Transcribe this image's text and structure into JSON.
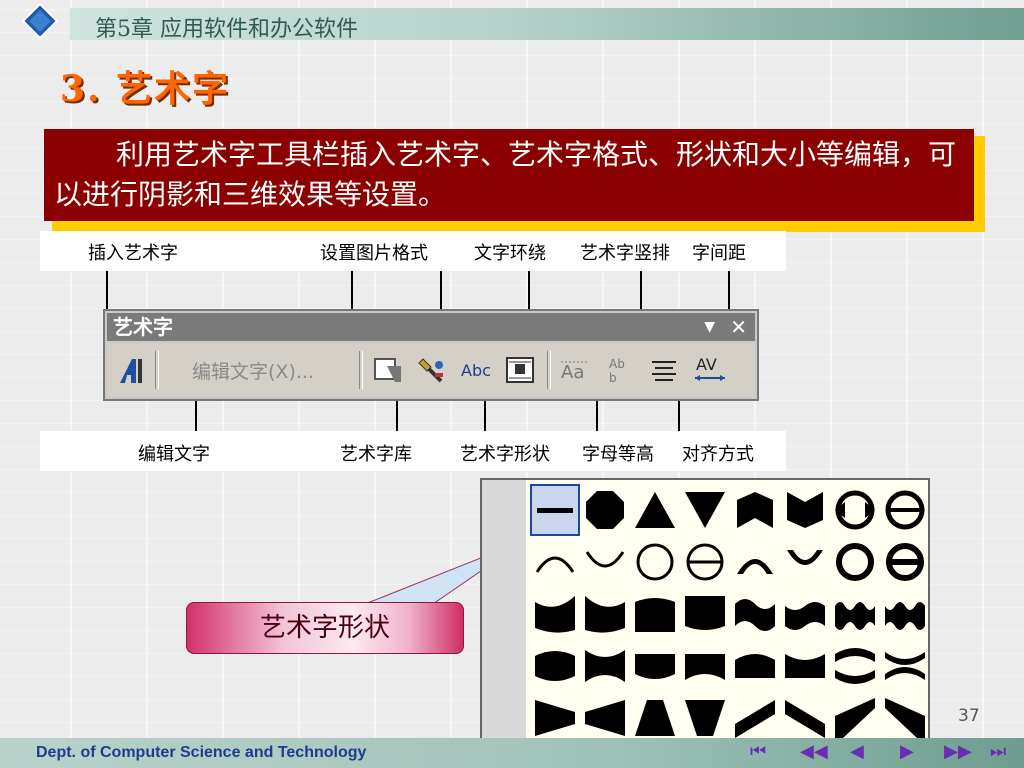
{
  "header": {
    "chapter": "第5章  应用软件和办公软件"
  },
  "heading": "3. 艺术字",
  "textbox": {
    "text": "利用艺术字工具栏插入艺术字、艺术字格式、形状和大小等编辑，可以进行阴影和三维效果等设置。"
  },
  "top_labels": [
    "插入艺术字",
    "设置图片格式",
    "文字环绕",
    "艺术字竖排",
    "字间距"
  ],
  "bottom_labels": [
    "编辑文字",
    "艺术字库",
    "艺术字形状",
    "字母等高",
    "对齐方式"
  ],
  "toolbar": {
    "title": "艺术字",
    "edit_text": "编辑文字(X)...",
    "dropdown_icon": "▼",
    "close_icon": "✕"
  },
  "callout": {
    "label": "艺术字形状"
  },
  "footer": {
    "dept": "Dept. of Computer Science and Technology",
    "page": "37"
  },
  "colors": {
    "accent": "#ff6600",
    "textbox_bg": "#8b0000",
    "textbox_shadow": "#ffcc00",
    "footer_text": "#1f3c8c"
  }
}
